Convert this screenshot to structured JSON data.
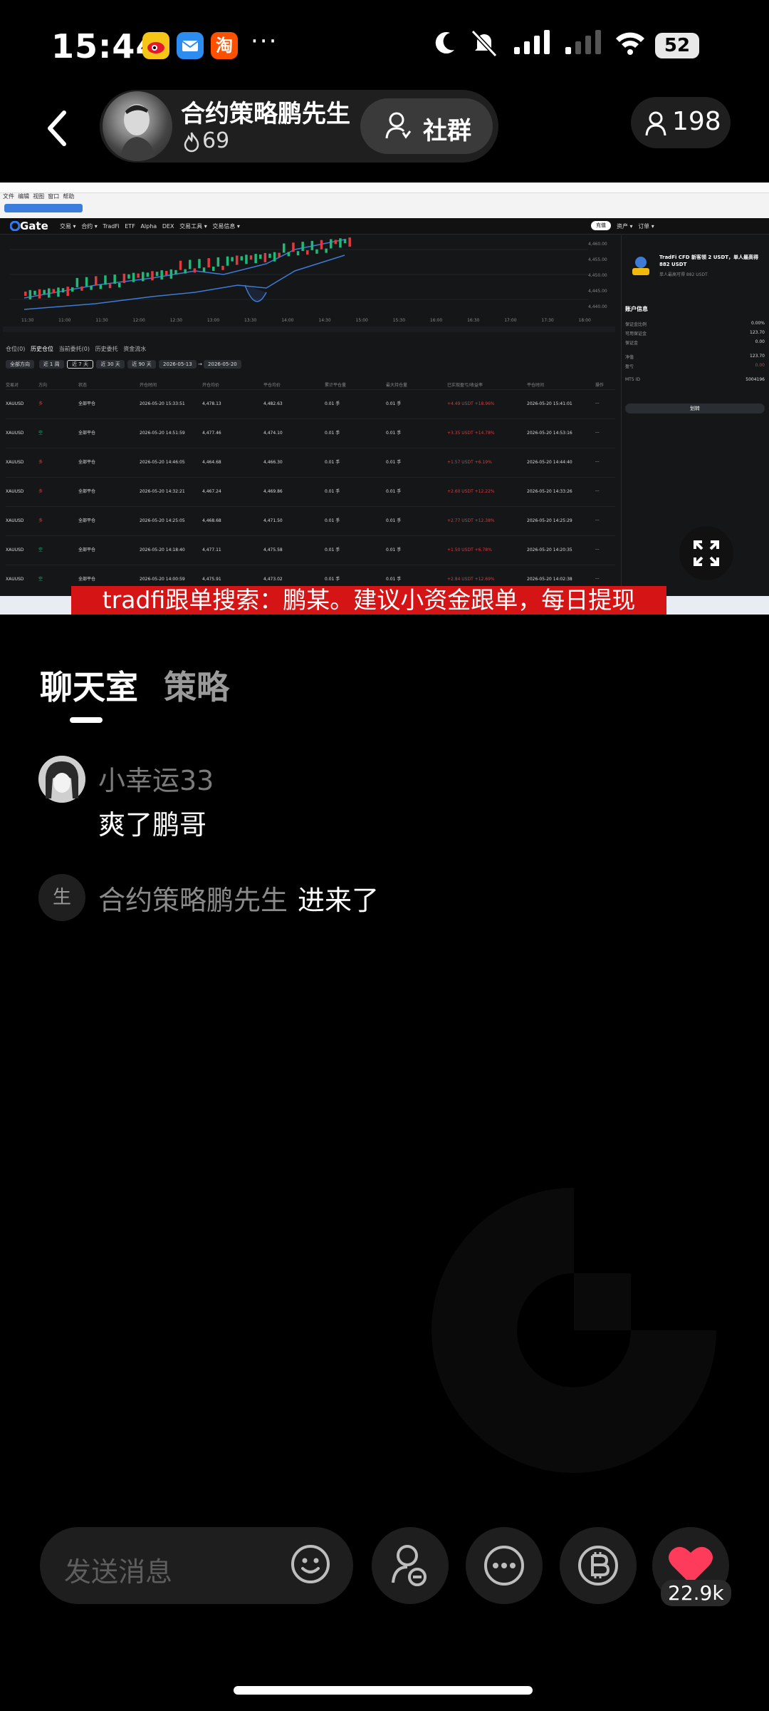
{
  "status_bar": {
    "time": "15:44",
    "more": "···",
    "battery": "52"
  },
  "header": {
    "host_name": "合约策略鹏先生",
    "host_heat": "69",
    "group_button": "社群",
    "viewer_count": "198"
  },
  "stream": {
    "banner_text": "tradfi跟单搜索：鹏某。建议小资金跟单，每日提现",
    "browser_menu": [
      "文件",
      "编辑",
      "视图",
      "窗口",
      "帮助"
    ],
    "site_nav": [
      "交易",
      "合约",
      "TradFi",
      "ETF",
      "Alpha",
      "DEX",
      "交易工具",
      "交易信息"
    ],
    "nav_right": [
      "资产",
      "订单"
    ],
    "login_btn": "充值",
    "panel_tabs": [
      "仓位(0)",
      "历史仓位",
      "当前委托(0)",
      "历史委托",
      "资金流水"
    ],
    "filters": [
      "全部方向",
      "近 1 周",
      "近 7 天",
      "近 30 天",
      "近 90 天",
      "2026-05-13",
      "2026-05-20"
    ],
    "table_headers": [
      "交易对",
      "方向",
      "状态",
      "开仓时间",
      "开仓均价",
      "平仓均价",
      "累计平仓量",
      "最大持仓量",
      "已实现盈亏/收益率",
      "平仓时间",
      "操作"
    ],
    "rows": [
      {
        "pair": "XAUUSD",
        "dir": "多",
        "status": "全部平仓",
        "open": "2026-05-20 15:33:51",
        "open_px": "4,478.13",
        "close_px": "4,482.63",
        "vol": "0.01 手",
        "max": "0.01 手",
        "pnl": "+4.49 USDT",
        "pnl_pct": "+18.96%",
        "close_time": "2026-05-20 15:41:01",
        "up": true
      },
      {
        "pair": "XAUUSD",
        "dir": "空",
        "status": "全部平仓",
        "open": "2026-05-20 14:51:59",
        "open_px": "4,477.46",
        "close_px": "4,474.10",
        "vol": "0.01 手",
        "max": "0.01 手",
        "pnl": "+3.35 USDT",
        "pnl_pct": "+14.78%",
        "close_time": "2026-05-20 14:53:16",
        "up": true
      },
      {
        "pair": "XAUUSD",
        "dir": "多",
        "status": "全部平仓",
        "open": "2026-05-20 14:46:05",
        "open_px": "4,464.68",
        "close_px": "4,466.30",
        "vol": "0.01 手",
        "max": "0.01 手",
        "pnl": "+1.57 USDT",
        "pnl_pct": "+6.19%",
        "close_time": "2026-05-20 14:44:40",
        "up": true
      },
      {
        "pair": "XAUUSD",
        "dir": "多",
        "status": "全部平仓",
        "open": "2026-05-20 14:32:21",
        "open_px": "4,467.24",
        "close_px": "4,469.86",
        "vol": "0.01 手",
        "max": "0.01 手",
        "pnl": "+2.60 USDT",
        "pnl_pct": "+12.22%",
        "close_time": "2026-05-20 14:33:26",
        "up": true
      },
      {
        "pair": "XAUUSD",
        "dir": "多",
        "status": "全部平仓",
        "open": "2026-05-20 14:25:05",
        "open_px": "4,468.68",
        "close_px": "4,471.50",
        "vol": "0.01 手",
        "max": "0.01 手",
        "pnl": "+2.77 USDT",
        "pnl_pct": "+12.38%",
        "close_time": "2026-05-20 14:25:29",
        "up": true
      },
      {
        "pair": "XAUUSD",
        "dir": "空",
        "status": "全部平仓",
        "open": "2026-05-20 14:18:40",
        "open_px": "4,477.11",
        "close_px": "4,475.58",
        "vol": "0.01 手",
        "max": "0.01 手",
        "pnl": "+1.50 USDT",
        "pnl_pct": "+6.78%",
        "close_time": "2026-05-20 14:20:35",
        "up": true
      },
      {
        "pair": "XAUUSD",
        "dir": "空",
        "status": "全部平仓",
        "open": "2026-05-20 14:00:59",
        "open_px": "4,475.91",
        "close_px": "4,473.02",
        "vol": "0.01 手",
        "max": "0.01 手",
        "pnl": "+2.84 USDT",
        "pnl_pct": "+12.69%",
        "close_time": "2026-05-20 14:02:38",
        "up": true
      }
    ],
    "promo_title": "TradFi CFD 新客领 2 USDT，单人最高得 882 USDT",
    "promo_sub": "单人最高可得 882 USDT",
    "account_title": "账户信息",
    "account_rows": [
      {
        "label": "保证金比例",
        "value": "0.00%"
      },
      {
        "label": "可用保证金",
        "value": "123.70"
      },
      {
        "label": "保证金",
        "value": "0.00"
      },
      {
        "label": "净值",
        "value": "123.70"
      },
      {
        "label": "盈亏",
        "value": "0.00"
      },
      {
        "label": "MT5 ID",
        "value": "5004196"
      }
    ],
    "transfer_btn": "划转",
    "price_ticks": [
      "4,460.00",
      "4,455.00",
      "4,450.00",
      "4,445.00",
      "4,440.00"
    ],
    "time_ticks": [
      "11:30",
      "11:00",
      "11:30",
      "12:00",
      "12:30",
      "13:00",
      "13:30",
      "14:00",
      "14:30",
      "15:00",
      "15:30",
      "16:00",
      "16:30",
      "17:00",
      "17:30",
      "18:00"
    ]
  },
  "tabs": {
    "chat": "聊天室",
    "strategy": "策略"
  },
  "chat": [
    {
      "user": "小幸运33",
      "message": "爽了鹏哥"
    }
  ],
  "join_notice": {
    "avatar_char": "生",
    "user": "合约策略鹏先生",
    "text": "进来了"
  },
  "bottom_bar": {
    "input_placeholder": "发送消息",
    "like_count": "22.9k"
  },
  "colors": {
    "background": "#000000",
    "banner_red": "#d51416",
    "heart_red": "#ff3b5c",
    "profit_red": "#e0393e"
  }
}
